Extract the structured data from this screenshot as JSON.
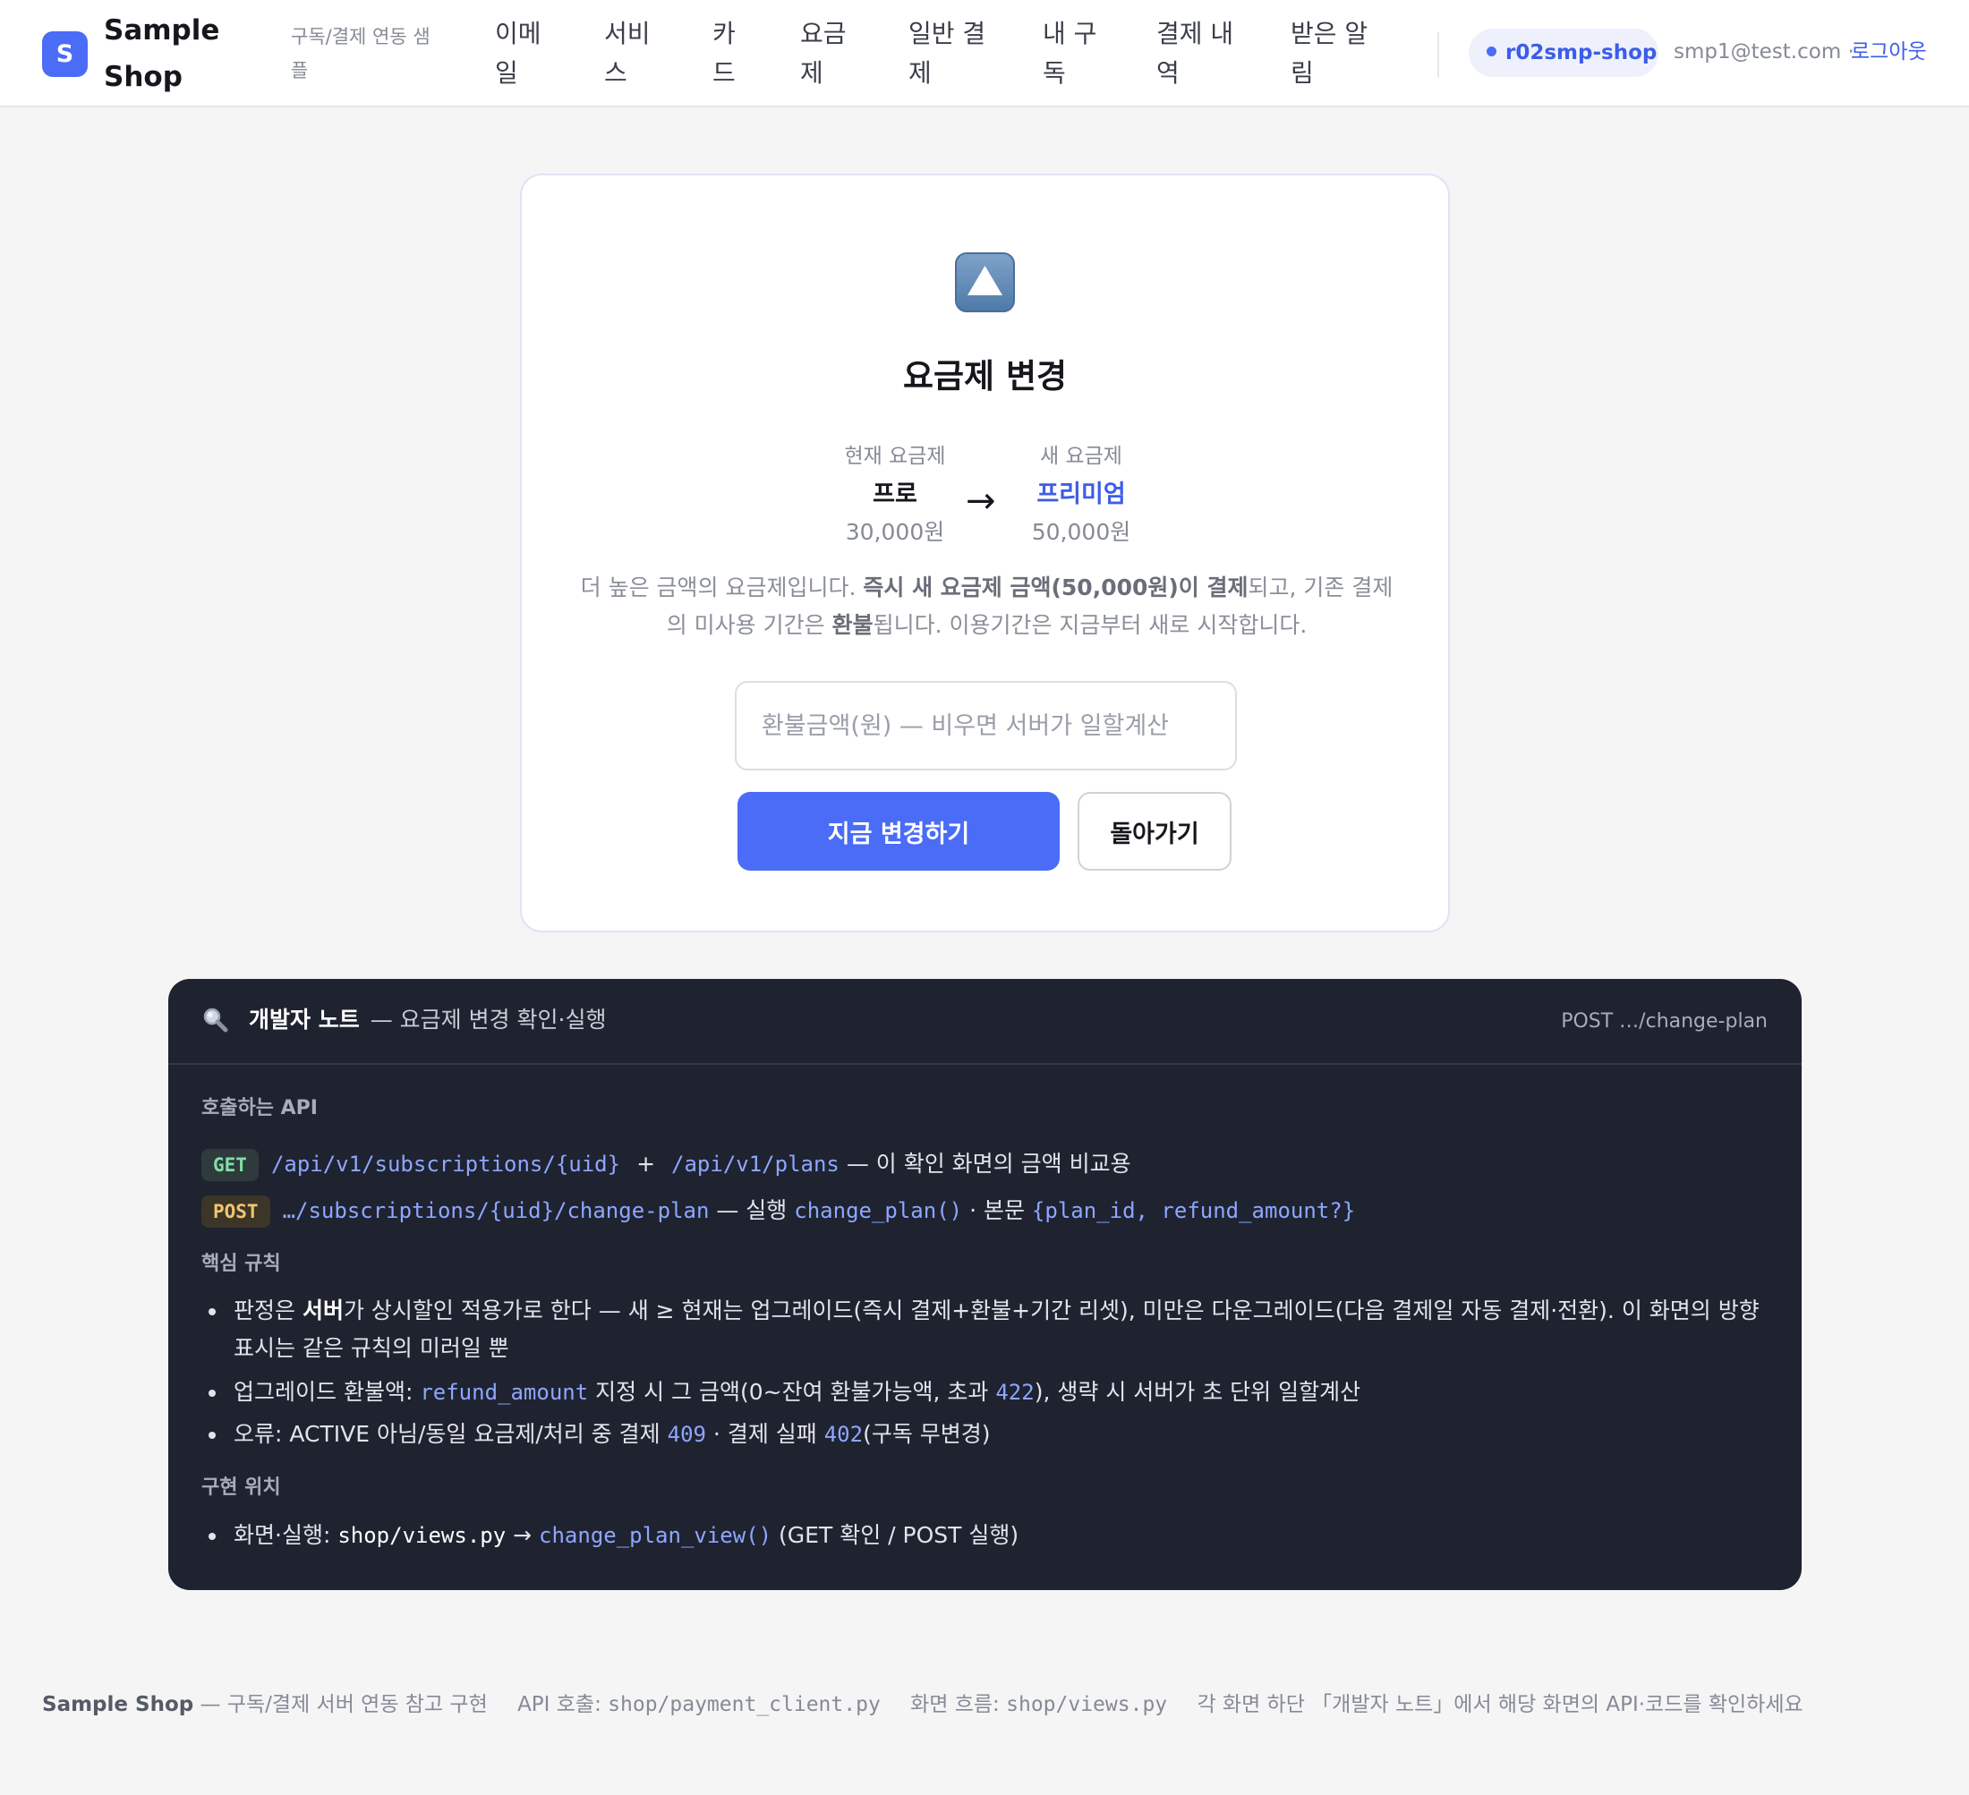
{
  "header": {
    "logo_letter": "S",
    "brand": "Sample Shop",
    "tagline": "구독/결제 연동 샘플",
    "nav": [
      {
        "id": "email",
        "label": "이메일"
      },
      {
        "id": "service",
        "label": "서비스"
      },
      {
        "id": "card",
        "label": "카드"
      },
      {
        "id": "plan",
        "label": "요금제"
      },
      {
        "id": "payment",
        "label": "일반 결제"
      },
      {
        "id": "my-sub",
        "label": "내 구독"
      },
      {
        "id": "history",
        "label": "결제 내역"
      },
      {
        "id": "alerts",
        "label": "받은 알림"
      }
    ],
    "shop_id": "r02smp-shop",
    "user_email": "smp1@test.com ·",
    "logout_label": "로그아웃"
  },
  "card": {
    "title": "요금제 변경",
    "current_label": "현재 요금제",
    "current_name": "프로",
    "current_price": "30,000원",
    "arrow": "→",
    "new_label": "새 요금제",
    "new_name": "프리미엄",
    "new_price": "50,000원",
    "desc_1": "더 높은 금액의 요금제입니다. ",
    "desc_bold_1": "즉시 새 요금제 금액(50,000원)이 결제",
    "desc_2": "되고, 기존 결제의 미사용 기간은 ",
    "desc_bold_2": "환불",
    "desc_3": "됩니다. 이용기간은 지금부터 새로 시작합니다.",
    "refund_placeholder": "환불금액(원) — 비우면 서버가 일할계산",
    "submit_label": "지금 변경하기",
    "back_label": "돌아가기",
    "accent": "#4a6cf7"
  },
  "devnote": {
    "icon": "magnifier-icon",
    "title": "개발자 노트",
    "subtitle": "— 요금제 변경 확인·실행",
    "endpoint": "POST …/change-plan",
    "api_label": "호출하는 API",
    "get_badge": "GET",
    "get_path_1": "/api/v1/subscriptions/{uid}",
    "plus": "+",
    "get_path_2": "/api/v1/plans",
    "get_note": "— 이 확인 화면의 금액 비교용",
    "post_badge": "POST",
    "post_path": "…/subscriptions/{uid}/change-plan",
    "post_note_1": "— 실행",
    "post_fn": "change_plan()",
    "post_note_2": "· 본문",
    "post_body": "{plan_id, refund_amount?}",
    "rules_label": "핵심 규칙",
    "rule1_a": "판정은 ",
    "rule1_bold": "서버",
    "rule1_b": "가 상시할인 적용가로 한다 — 새 ≥ 현재는 업그레이드(즉시 결제+환불+기간 리셋), 미만은 다운그레이드(다음 결제일 자동 결제·전환). 이 화면의 방향 표시는 같은 규칙의 미러일 뿐",
    "rule2_a": "업그레이드 환불액: ",
    "rule2_code": "refund_amount",
    "rule2_b": " 지정 시 그 금액(0~잔여 환불가능액, 초과 ",
    "rule2_code2": "422",
    "rule2_c": "), 생략 시 서버가 초 단위 일할계산",
    "rule3_a": "오류: ACTIVE 아님/동일 요금제/처리 중 결제 ",
    "rule3_code": "409",
    "rule3_b": " · 결제 실패 ",
    "rule3_code2": "402",
    "rule3_c": "(구독 무변경)",
    "impl_label": "구현 위치",
    "impl_a": "화면·실행: ",
    "impl_file": "shop/views.py",
    "impl_arrow": " → ",
    "impl_fn": "change_plan_view()",
    "impl_b": " (GET 확인 / POST 실행)"
  },
  "footer": {
    "brand": "Sample Shop",
    "brand_desc": " — 구독/결제 서버 연동 참고 구현",
    "api_label": "API 호출: ",
    "api_file": "shop/payment_client.py",
    "flow_label": "화면 흐름: ",
    "flow_file": "shop/views.py",
    "hint": "각 화면 하단 「개발자 노트」에서 해당 화면의 API·코드를 확인하세요"
  }
}
